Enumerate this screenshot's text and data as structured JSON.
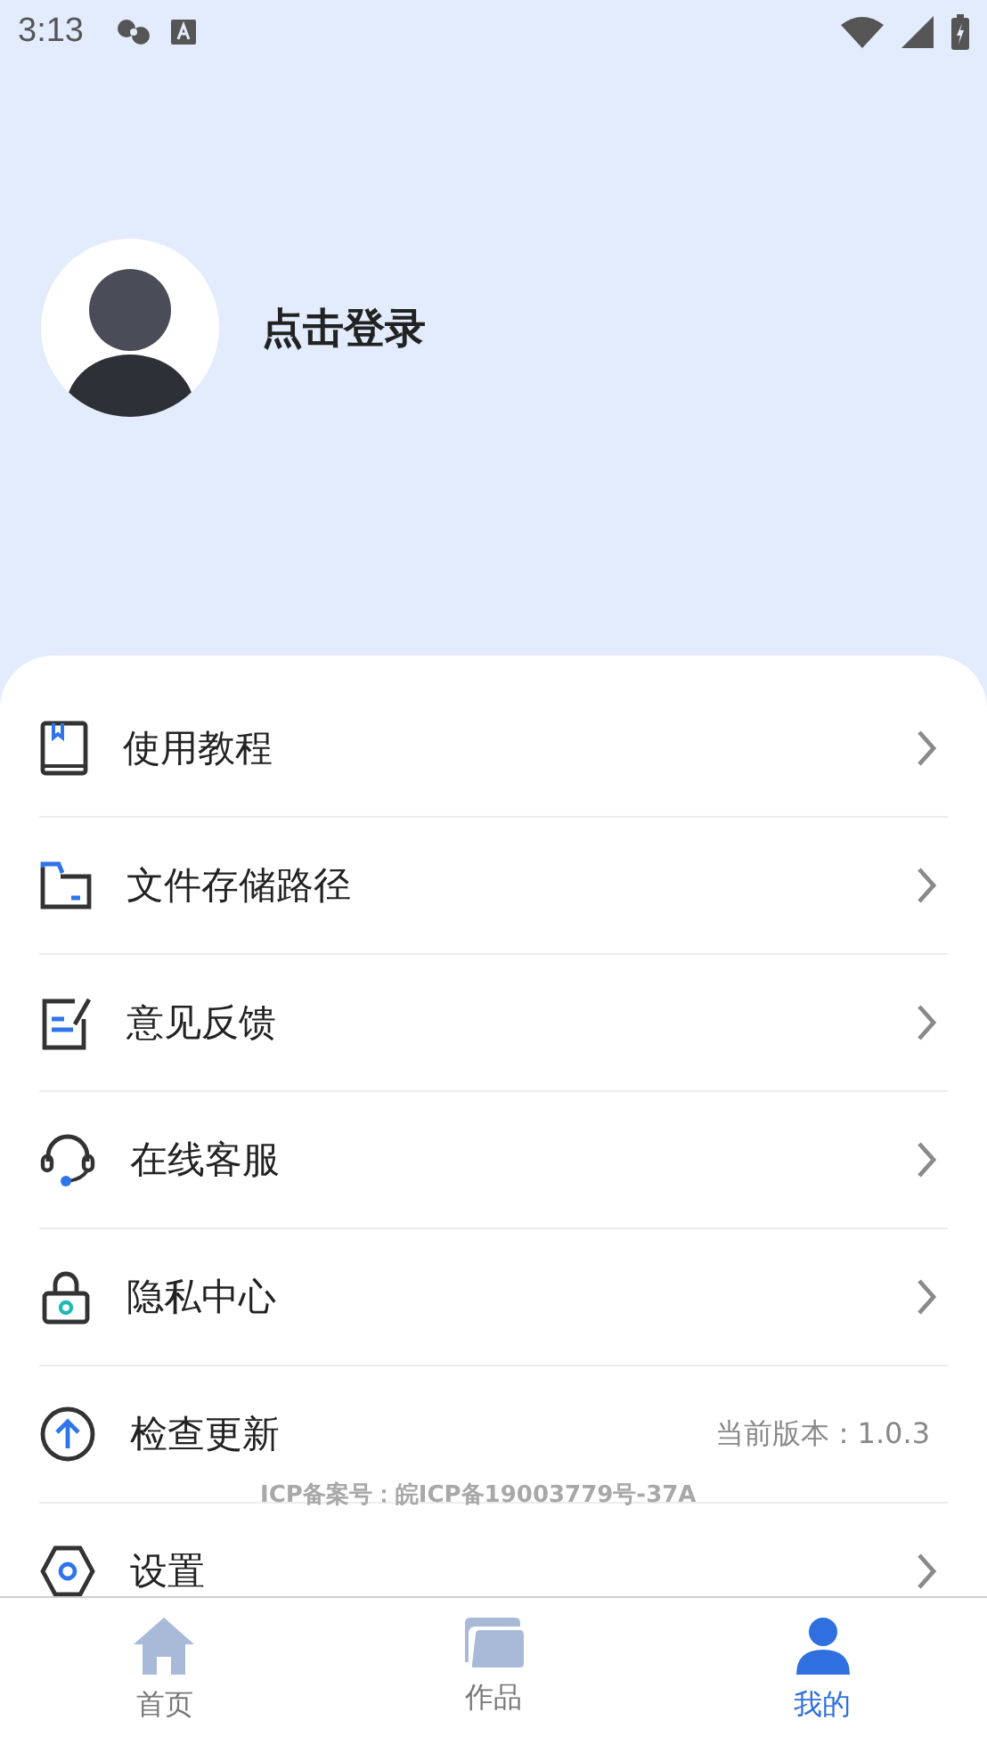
{
  "status_bar": {
    "time": "3:13"
  },
  "profile": {
    "login_label": "点击登录"
  },
  "menu": [
    {
      "label": "使用教程",
      "kind": "link"
    },
    {
      "label": "文件存储路径",
      "kind": "link"
    },
    {
      "label": "意见反馈",
      "kind": "link"
    },
    {
      "label": "在线客服",
      "kind": "link"
    },
    {
      "label": "隐私中心",
      "kind": "link"
    },
    {
      "label": "检查更新",
      "kind": "value",
      "value": "当前版本：1.0.3"
    },
    {
      "label": "设置",
      "kind": "link"
    }
  ],
  "icp_note": "ICP备案号：皖ICP备19003779号-37A",
  "tabs": [
    {
      "label": "首页",
      "selected": false
    },
    {
      "label": "作品",
      "selected": false
    },
    {
      "label": "我的",
      "selected": true
    }
  ]
}
